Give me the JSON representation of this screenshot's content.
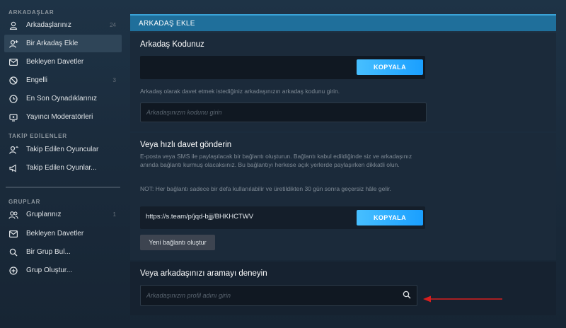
{
  "sidebar": {
    "friends_title": "ARKADAŞLAR",
    "friends_items": [
      {
        "label": "Arkadaşlarınız",
        "count": "24",
        "icon": "user-icon"
      },
      {
        "label": "Bir Arkadaş Ekle",
        "icon": "add-user-icon",
        "active": true
      },
      {
        "label": "Bekleyen Davetler",
        "icon": "envelope-icon"
      },
      {
        "label": "Engelli",
        "count": "3",
        "icon": "block-icon"
      },
      {
        "label": "En Son Oynadıklarınız",
        "icon": "clock-icon"
      },
      {
        "label": "Yayıncı Moderatörleri",
        "icon": "broadcast-icon"
      }
    ],
    "following_title": "TAKİP EDİLENLER",
    "following_items": [
      {
        "label": "Takip Edilen Oyuncular",
        "icon": "user-follow-icon"
      },
      {
        "label": "Takip Edilen Oyunlar...",
        "icon": "megaphone-icon"
      }
    ],
    "groups_title": "GRUPLAR",
    "group_items": [
      {
        "label": "Gruplarınız",
        "count": "1",
        "icon": "group-icon"
      },
      {
        "label": "Bekleyen Davetler",
        "icon": "envelope-icon"
      },
      {
        "label": "Bir Grup Bul...",
        "icon": "search-icon"
      },
      {
        "label": "Grup Oluştur...",
        "icon": "plus-circle-icon"
      }
    ]
  },
  "main": {
    "header": "ARKADAŞ EKLE",
    "code_section": {
      "title": "Arkadaş Kodunuz",
      "copy_label": "KOPYALA",
      "description": "Arkadaş olarak davet etmek istediğiniz arkadaşınızın arkadaş kodunu girin.",
      "input_placeholder": "Arkadaşınızın kodunu girin"
    },
    "invite_section": {
      "title": "Veya hızlı davet gönderin",
      "description": "E-posta veya SMS ile paylaşılacak bir bağlantı oluşturun. Bağlantı kabul edildiğinde siz ve arkadaşınız anında bağlantı kurmuş olacaksınız. Bu bağlantıyı herkese açık yerlerde paylaşırken dikkatli olun.",
      "note": "NOT: Her bağlantı sadece bir defa kullanılabilir ve üretildikten 30 gün sonra geçersiz hâle gelir.",
      "link": "https://s.team/p/jqd-bjjj/BHKHCTWV",
      "copy_label": "KOPYALA",
      "new_link_label": "Yeni bağlantı oluştur"
    },
    "search_section": {
      "title": "Veya arkadaşınızı aramayı deneyin",
      "input_placeholder": "Arkadaşınızın profil adını girin"
    }
  },
  "colors": {
    "accent_blue": "#1a9fff",
    "header_blue": "#1f6f9b",
    "annotation_arrow": "#d81e1e"
  }
}
